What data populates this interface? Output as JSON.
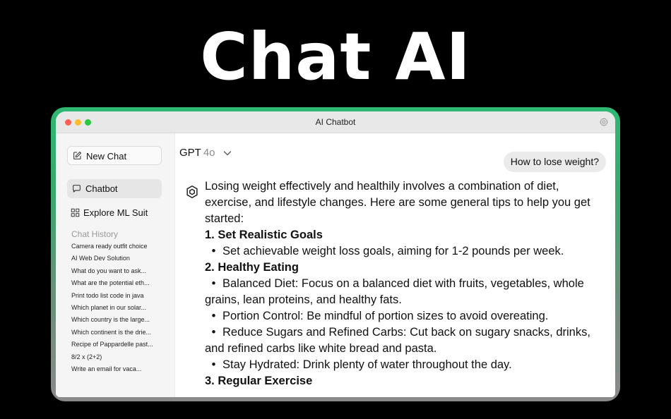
{
  "hero": {
    "title": "Chat AI"
  },
  "window": {
    "title": "AI Chatbot"
  },
  "sidebar": {
    "new_chat": "New Chat",
    "nav": [
      {
        "label": "Chatbot",
        "icon": "chat-bubble-icon",
        "selected": true
      },
      {
        "label": "Explore ML Suit",
        "icon": "grid-icon",
        "selected": false
      }
    ],
    "history_heading": "Chat History",
    "history": [
      "Camera ready outfit choice",
      "AI Web Dev Solution",
      "What do you want to ask...",
      "What are the potential eth...",
      "Print todo list code in java",
      "Which planet in our solar...",
      "Which country is the large...",
      "Which continent is the drie...",
      "Recipe of Pappardelle past...",
      "8/2 x (2+2)",
      "Write an email for vaca..."
    ]
  },
  "main": {
    "model_name": "GPT",
    "model_version": "4o",
    "user_message": "How to lose weight?",
    "reply": {
      "intro": "Losing weight effectively and healthily involves a combination of diet, exercise, and lifestyle changes. Here are some general tips to help you get started:",
      "h1": "1. Set Realistic Goals",
      "b1": "Set achievable weight loss goals, aiming for 1-2 pounds per week.",
      "h2": "2. Healthy Eating",
      "b2": "Balanced Diet: Focus on a balanced diet with fruits, vegetables, whole grains, lean proteins, and healthy fats.",
      "b3": "Portion Control: Be mindful of portion sizes to avoid overeating.",
      "b4": "Reduce Sugars and Refined Carbs: Cut back on sugary snacks, drinks, and refined carbs like white bread and pasta.",
      "b5": "Stay Hydrated: Drink plenty of water throughout the day.",
      "h3": "3. Regular Exercise"
    }
  },
  "colors": {
    "frame_accent": "#2eb872",
    "traffic_red": "#ff5f57",
    "traffic_yellow": "#febc2e",
    "traffic_green": "#28c840"
  }
}
